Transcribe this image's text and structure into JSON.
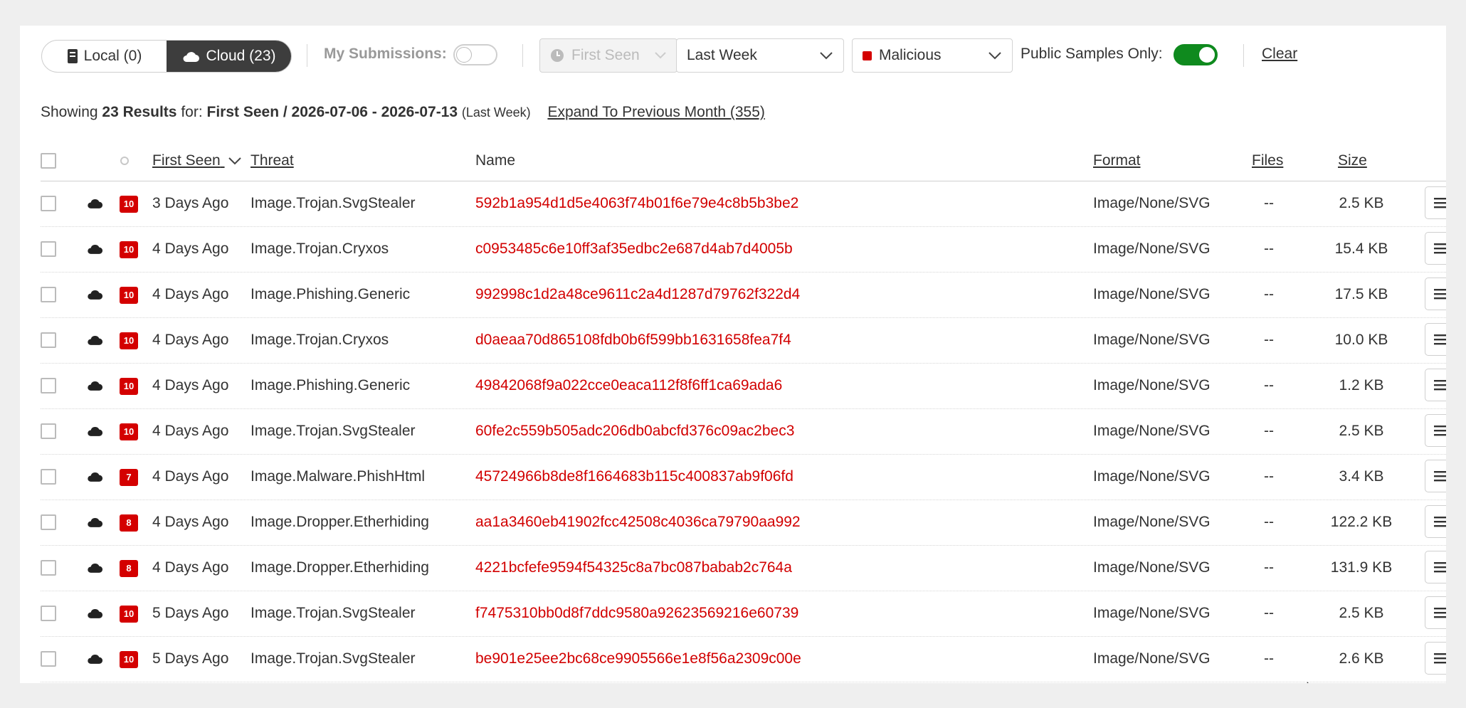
{
  "filters": {
    "local_tab": "Local (0)",
    "cloud_tab": "Cloud (23)",
    "my_submissions_label": "My Submissions:",
    "my_submissions_on": false,
    "date_field": "First Seen",
    "date_range": "Last Week",
    "verdict": "Malicious",
    "public_only_label": "Public Samples Only:",
    "public_only_on": true,
    "clear_label": "Clear"
  },
  "summary": {
    "prefix": "Showing",
    "count": "23 Results",
    "for": "for:",
    "field": "First Seen / 2026-07-06 - 2026-07-13",
    "range_note": "(Last Week)",
    "expand_link": "Expand To Previous Month (355)"
  },
  "table": {
    "headers": {
      "first_seen": "First Seen",
      "threat": "Threat",
      "name": "Name",
      "format": "Format",
      "files": "Files",
      "size": "Size"
    },
    "rows": [
      {
        "score": "10",
        "seen": "3 Days Ago",
        "threat": "Image.Trojan.SvgStealer",
        "name": "592b1a954d1d5e4063f74b01f6e79e4c8b5b3be2",
        "format": "Image/None/SVG",
        "files": "--",
        "size": "2.5 KB"
      },
      {
        "score": "10",
        "seen": "4 Days Ago",
        "threat": "Image.Trojan.Cryxos",
        "name": "c0953485c6e10ff3af35edbc2e687d4ab7d4005b",
        "format": "Image/None/SVG",
        "files": "--",
        "size": "15.4 KB"
      },
      {
        "score": "10",
        "seen": "4 Days Ago",
        "threat": "Image.Phishing.Generic",
        "name": "992998c1d2a48ce9611c2a4d1287d79762f322d4",
        "format": "Image/None/SVG",
        "files": "--",
        "size": "17.5 KB"
      },
      {
        "score": "10",
        "seen": "4 Days Ago",
        "threat": "Image.Trojan.Cryxos",
        "name": "d0aeaa70d865108fdb0b6f599bb1631658fea7f4",
        "format": "Image/None/SVG",
        "files": "--",
        "size": "10.0 KB"
      },
      {
        "score": "10",
        "seen": "4 Days Ago",
        "threat": "Image.Phishing.Generic",
        "name": "49842068f9a022cce0eaca112f8f6ff1ca69ada6",
        "format": "Image/None/SVG",
        "files": "--",
        "size": "1.2 KB"
      },
      {
        "score": "10",
        "seen": "4 Days Ago",
        "threat": "Image.Trojan.SvgStealer",
        "name": "60fe2c559b505adc206db0abcfd376c09ac2bec3",
        "format": "Image/None/SVG",
        "files": "--",
        "size": "2.5 KB"
      },
      {
        "score": "7",
        "seen": "4 Days Ago",
        "threat": "Image.Malware.PhishHtml",
        "name": "45724966b8de8f1664683b115c400837ab9f06fd",
        "format": "Image/None/SVG",
        "files": "--",
        "size": "3.4 KB"
      },
      {
        "score": "8",
        "seen": "4 Days Ago",
        "threat": "Image.Dropper.Etherhiding",
        "name": "aa1a3460eb41902fcc42508c4036ca79790aa992",
        "format": "Image/None/SVG",
        "files": "--",
        "size": "122.2 KB"
      },
      {
        "score": "8",
        "seen": "4 Days Ago",
        "threat": "Image.Dropper.Etherhiding",
        "name": "4221bcfefe9594f54325c8a7bc087babab2c764a",
        "format": "Image/None/SVG",
        "files": "--",
        "size": "131.9 KB"
      },
      {
        "score": "10",
        "seen": "5 Days Ago",
        "threat": "Image.Trojan.SvgStealer",
        "name": "f7475310bb0d8f7ddc9580a92623569216e60739",
        "format": "Image/None/SVG",
        "files": "--",
        "size": "2.5 KB"
      },
      {
        "score": "10",
        "seen": "5 Days Ago",
        "threat": "Image.Trojan.SvgStealer",
        "name": "be901e25ee2bc68ce9905566e1e8f56a2309c00e",
        "format": "Image/None/SVG",
        "files": "--",
        "size": "2.6 KB"
      }
    ]
  },
  "colors": {
    "accent_red": "#d20000",
    "toggle_on": "#0f8a1e",
    "segment_active": "#3d3d3d"
  },
  "icons": {
    "local": "server-icon",
    "cloud": "cloud-icon",
    "date": "clock-icon",
    "row_menu": "hamburger-menu-icon"
  }
}
